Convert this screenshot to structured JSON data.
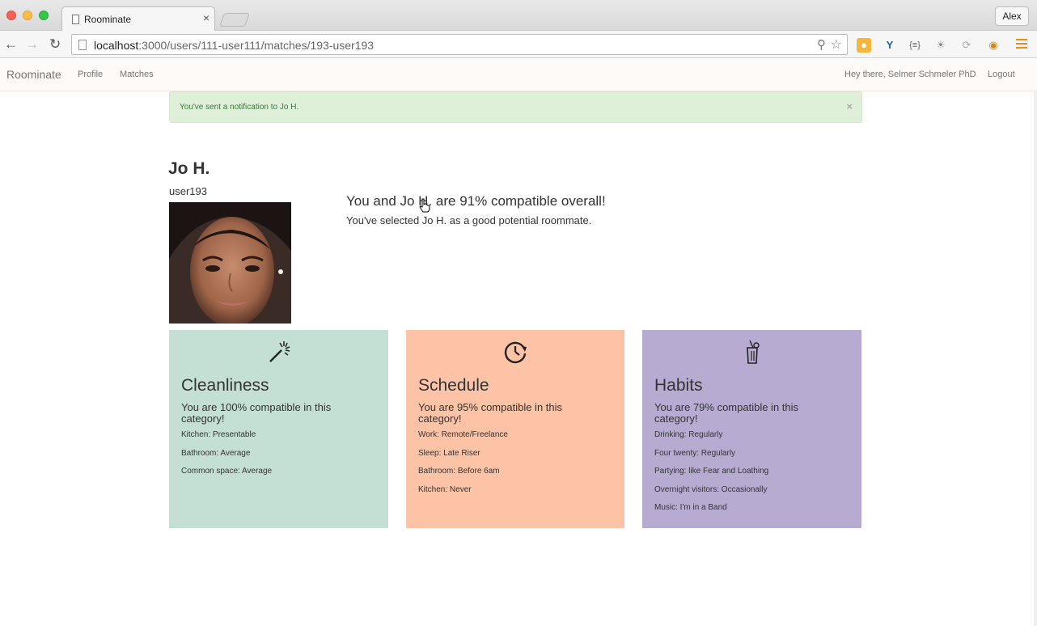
{
  "browser": {
    "tab_title": "Roominate",
    "tab_close": "×",
    "profile_name": "Alex",
    "url_host": "localhost",
    "url_path": ":3000/users/111-user111/matches/193-user193"
  },
  "navbar": {
    "brand": "Roominate",
    "links": [
      "Profile",
      "Matches"
    ],
    "greeting": "Hey there, Selmer Schmeler PhD",
    "logout": "Logout"
  },
  "alert": {
    "message": "You've sent a notification to Jo H.",
    "close": "×"
  },
  "match": {
    "name": "Jo H.",
    "username": "user193",
    "compat_title": "You and Jo H. are 91% compatible overall!",
    "compat_sub": "You've selected Jo H. as a good potential roommate."
  },
  "categories": [
    {
      "icon": "magic-wand-icon",
      "title": "Cleanliness",
      "compat": "You are 100% compatible in this category!",
      "items": [
        "Kitchen: Presentable",
        "Bathroom: Average",
        "Common space: Average"
      ],
      "color": "#c4e0d5"
    },
    {
      "icon": "clock-icon",
      "title": "Schedule",
      "compat": "You are 95% compatible in this category!",
      "items": [
        "Work: Remote/Freelance",
        "Sleep: Late Riser",
        "Bathroom: Before 6am",
        "Kitchen: Never"
      ],
      "color": "#fdc3a7"
    },
    {
      "icon": "drink-icon",
      "title": "Habits",
      "compat": "You are 79% compatible in this category!",
      "items": [
        "Drinking: Regularly",
        "Four twenty: Regularly",
        "Partying: like Fear and Loathing",
        "Overnight visitors: Occasionally",
        "Music: I'm in a Band"
      ],
      "color": "#b7abd1"
    }
  ]
}
